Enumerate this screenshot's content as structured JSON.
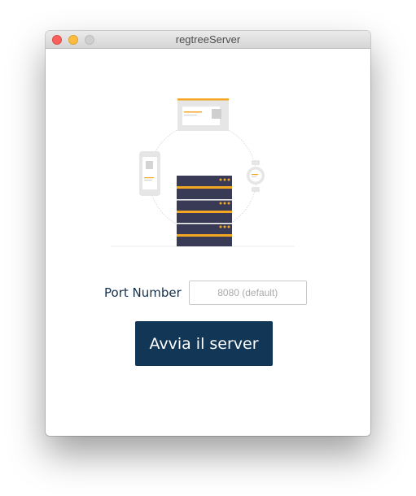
{
  "window": {
    "title": "regtreeServer"
  },
  "illustration": {
    "icons": [
      "browser-window-icon",
      "smartphone-icon",
      "smartwatch-icon",
      "server-rack-icon"
    ],
    "colors": {
      "server_dark": "#393a56",
      "accent": "#f5a623",
      "device_gray": "#e6e6e6"
    }
  },
  "form": {
    "port_label": "Port Number",
    "port_value": "",
    "port_placeholder": "8080 (default)",
    "start_button_label": "Avvia il server"
  },
  "colors": {
    "button_bg": "#123656",
    "label_text": "#14304d"
  }
}
